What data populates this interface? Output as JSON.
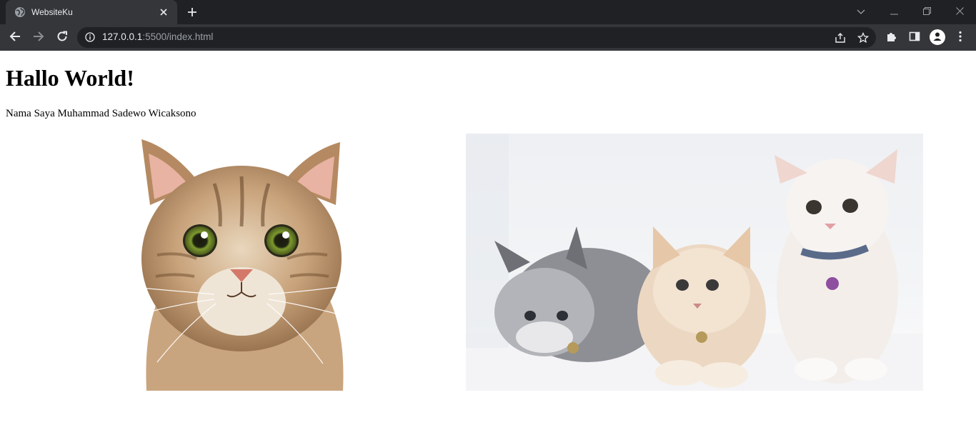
{
  "browser": {
    "tab_title": "WebsiteKu",
    "url_host": "127.0.0.1",
    "url_rest": ":5500/index.html",
    "icons": {
      "favicon": "globe-icon",
      "tab_close": "close-icon",
      "new_tab": "plus-icon",
      "tab_search": "chevron-down-icon",
      "minimize": "minimize-icon",
      "restore": "restore-icon",
      "close_window": "close-icon",
      "back": "arrow-left-icon",
      "forward": "arrow-right-icon",
      "reload": "reload-icon",
      "site_info": "info-icon",
      "share": "share-icon",
      "bookmark": "star-icon",
      "extensions": "puzzle-icon",
      "side_panel": "side-panel-icon",
      "profile": "person-icon",
      "menu": "more-vertical-icon"
    },
    "colors": {
      "tabstrip": "#202124",
      "toolbar": "#35363a",
      "omnibox": "#202124",
      "text": "#e8eaed",
      "muted": "#9aa0a6"
    }
  },
  "page": {
    "heading": "Hallo World!",
    "paragraph": "Nama Saya Muhammad Sadewo Wicaksono",
    "images": [
      {
        "subject": "close-up of a tabby cat face"
      },
      {
        "subject": "three fluffy kittens sitting on white background"
      }
    ]
  }
}
